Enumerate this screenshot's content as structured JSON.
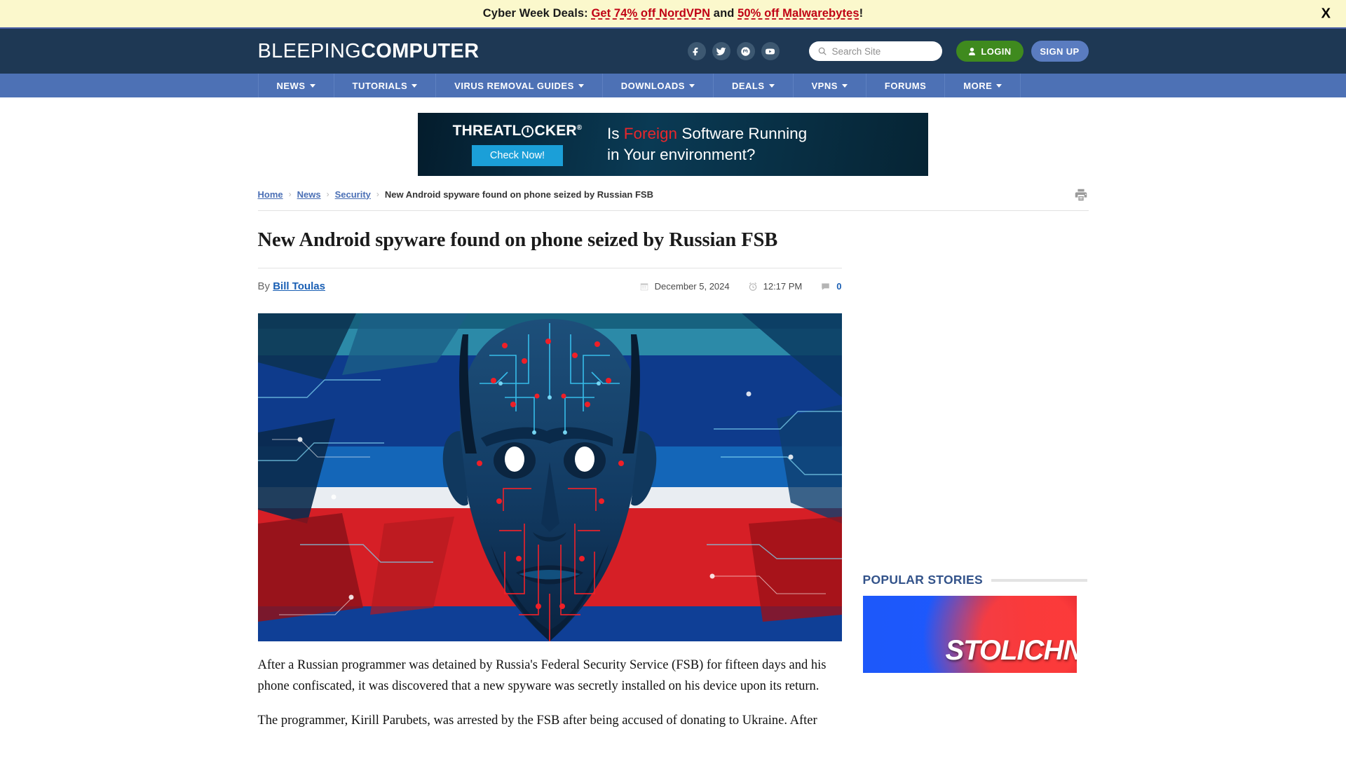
{
  "promo": {
    "prefix": "Cyber Week Deals:",
    "link1": "Get 74% off NordVPN",
    "conjunction": " and ",
    "link2": "50% off Malwarebytes",
    "suffix": "!",
    "close_label": "X"
  },
  "header": {
    "logo_light": "BLEEPING",
    "logo_bold": "COMPUTER",
    "social": [
      {
        "name": "facebook-icon",
        "label": "Facebook"
      },
      {
        "name": "twitter-icon",
        "label": "Twitter"
      },
      {
        "name": "mastodon-icon",
        "label": "Mastodon"
      },
      {
        "name": "youtube-icon",
        "label": "YouTube"
      }
    ],
    "search_placeholder": "Search Site",
    "search_value": "",
    "login_label": "LOGIN",
    "signup_label": "SIGN UP"
  },
  "nav": {
    "items": [
      {
        "label": "NEWS",
        "has_caret": true
      },
      {
        "label": "TUTORIALS",
        "has_caret": true
      },
      {
        "label": "VIRUS REMOVAL GUIDES",
        "has_caret": true
      },
      {
        "label": "DOWNLOADS",
        "has_caret": true
      },
      {
        "label": "DEALS",
        "has_caret": true
      },
      {
        "label": "VPNS",
        "has_caret": true
      },
      {
        "label": "FORUMS",
        "has_caret": false
      },
      {
        "label": "MORE",
        "has_caret": true
      }
    ]
  },
  "ad": {
    "brand_pre": "THREATL",
    "brand_post": "CKER",
    "registered": "®",
    "cta": "Check Now!",
    "line1_a": "Is ",
    "line1_hl": "Foreign",
    "line1_b": " Software Running",
    "line2": "in Your environment?"
  },
  "breadcrumb": {
    "items": [
      "Home",
      "News",
      "Security"
    ],
    "separator": "›",
    "current": "New Android spyware found on phone seized by Russian FSB",
    "print_icon": "printer-icon"
  },
  "article": {
    "title": "New Android spyware found on phone seized by Russian FSB",
    "by_prefix": "By ",
    "author": "Bill Toulas",
    "date": "December 5, 2024",
    "time": "12:17 PM",
    "comment_count": "0",
    "hero_alt": "Cybernetic face over Russian flag colors",
    "paragraphs": [
      "After a Russian programmer was detained by Russia's Federal Security Service (FSB) for fifteen days and his phone confiscated, it was discovered that a new spyware was secretly installed on his device upon its return.",
      "The programmer, Kirill Parubets, was arrested by the FSB after being accused of donating to Ukraine. After"
    ]
  },
  "sidebar": {
    "popular_title": "POPULAR STORIES",
    "thumb_word": "STOLICHN"
  },
  "colors": {
    "promo_bg": "#fbf8cc",
    "promo_link": "#c00014",
    "header_bg": "#1e3854",
    "nav_bg": "#4d71b5",
    "login_green": "#3f8a1e",
    "signup_blue": "#5a7cc0",
    "link_blue": "#1a5fb4",
    "crumb_blue": "#4a6fb5",
    "popular_heading": "#33538a"
  }
}
